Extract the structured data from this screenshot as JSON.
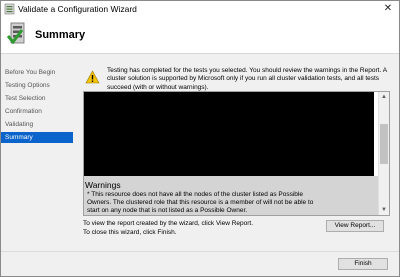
{
  "window": {
    "title": "Validate a Configuration Wizard",
    "close_glyph": "✕"
  },
  "header": {
    "title": "Summary",
    "icon": "cluster-validation-icon"
  },
  "sidebar": {
    "items": [
      {
        "label": "Before You Begin",
        "active": false
      },
      {
        "label": "Testing Options",
        "active": false
      },
      {
        "label": "Test Selection",
        "active": false
      },
      {
        "label": "Confirmation",
        "active": false
      },
      {
        "label": "Validating",
        "active": false
      },
      {
        "label": "Summary",
        "active": true
      }
    ]
  },
  "main": {
    "warning_icon": "warning-triangle-icon",
    "message": "Testing has completed for the tests you selected. You should review the warnings in the Report.  A cluster solution is supported by Microsoft only if you run all cluster validation tests, and all tests succeed (with or without warnings).",
    "report": {
      "section_title": "Warnings",
      "warning_text": "* This resource does not have all the nodes of the cluster listed as Possible Owners. The clustered role that this resource is a member of will not be able to start on any node that is not listed as a Possible Owner."
    },
    "footer_line1": "To view the report created by the wizard, click View Report.",
    "footer_line2": "To close this wizard, click Finish."
  },
  "buttons": {
    "view_report": "View Report...",
    "finish": "Finish"
  },
  "colors": {
    "accent": "#0a64cc",
    "warning": "#f5c400"
  }
}
